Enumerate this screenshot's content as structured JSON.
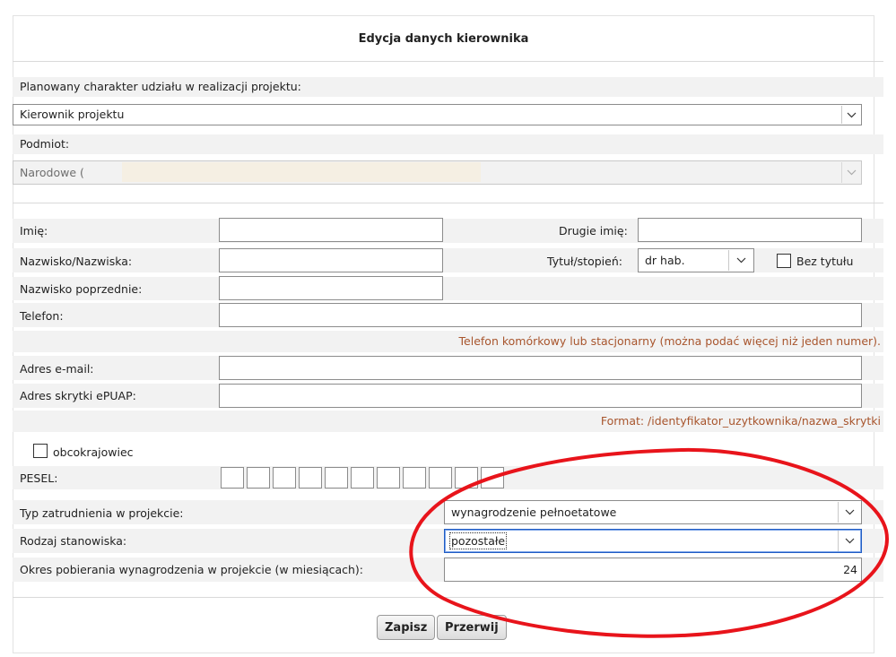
{
  "form": {
    "title": "Edycja danych kierownika",
    "role_label": "Planowany charakter udziału w realizacji projektu:",
    "role_value": "Kierownik projektu",
    "entity_label": "Podmiot:",
    "entity_value": "Narodowe (",
    "first_name_label": "Imię:",
    "first_name_value": "",
    "second_name_label": "Drugie imię:",
    "second_name_value": "",
    "last_name_label": "Nazwisko/Nazwiska:",
    "last_name_value": "",
    "degree_label": "Tytuł/stopień:",
    "degree_value": "dr hab.",
    "no_degree_label": "Bez tytułu",
    "previous_name_label": "Nazwisko poprzednie:",
    "previous_name_value": "",
    "phone_label": "Telefon:",
    "phone_value": "",
    "phone_hint": "Telefon komórkowy lub stacjonarny (można podać więcej niż jeden numer).",
    "email_label": "Adres e-mail:",
    "email_value": "",
    "epuap_label": "Adres skrytki ePUAP:",
    "epuap_value": "",
    "epuap_hint": "Format: /identyfikator_uzytkownika/nazwa_skrytki",
    "foreigner_label": "obcokrajowiec",
    "pesel_label": "PESEL:",
    "employment_type_label": "Typ zatrudnienia w projekcie:",
    "employment_type_value": "wynagrodzenie pełnoetatowe",
    "position_type_label": "Rodzaj stanowiska:",
    "position_type_value": "pozostałe",
    "salary_period_label": "Okres pobierania wynagrodzenia w projekcie (w miesiącach):",
    "salary_period_value": "24"
  },
  "buttons": {
    "save": "Zapisz",
    "cancel": "Przerwij"
  },
  "icons": {
    "dropdown": "chevron-down-icon",
    "annotation": "red-ellipse-annotation"
  },
  "colors": {
    "hint": "#a8552d",
    "annotation": "#e8141b",
    "band": "#f2f2f2"
  }
}
